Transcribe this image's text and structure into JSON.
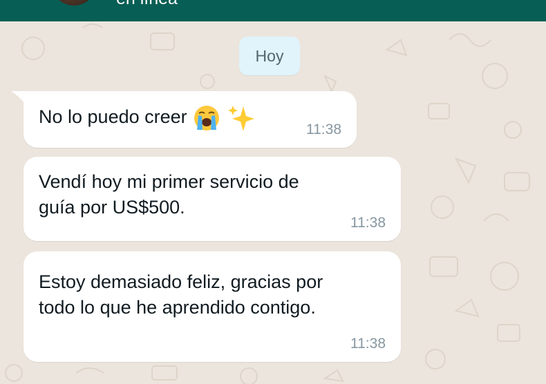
{
  "header": {
    "status": "en línea"
  },
  "day_divider": {
    "label": "Hoy"
  },
  "messages": [
    {
      "text": "No lo puedo creer",
      "emojis": [
        "loudly-crying-face",
        "sparkles"
      ],
      "time": "11:38"
    },
    {
      "lines": [
        "Vendí hoy mi primer servicio de",
        "guía por US$500."
      ],
      "time": "11:38"
    },
    {
      "lines": [
        "Estoy demasiado feliz, gracias por",
        "todo lo que he aprendido contigo."
      ],
      "time": "11:38"
    }
  ],
  "colors": {
    "header": "#075e54",
    "wallpaper": "#ece5dd",
    "bubble": "#ffffff",
    "day_chip": "#e1f3fb",
    "timestamp": "#8696a0"
  }
}
